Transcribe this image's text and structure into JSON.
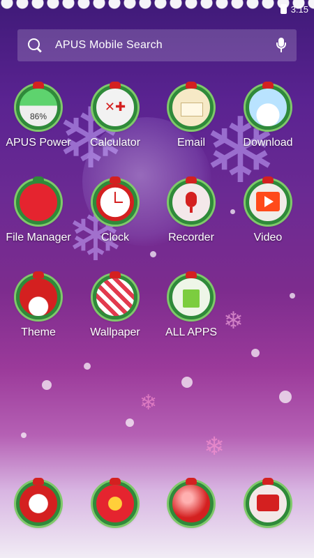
{
  "status_bar": {
    "time": "3:15"
  },
  "search": {
    "placeholder": "APUS Mobile Search"
  },
  "apps": [
    {
      "label": "APUS Power",
      "icon": "battery-icon",
      "badge": "86%"
    },
    {
      "label": "Calculator",
      "icon": "calculator-icon"
    },
    {
      "label": "Email",
      "icon": "email-icon"
    },
    {
      "label": "Download",
      "icon": "download-icon"
    },
    {
      "label": "File Manager",
      "icon": "folder-icon"
    },
    {
      "label": "Clock",
      "icon": "clock-icon"
    },
    {
      "label": "Recorder",
      "icon": "microphone-icon"
    },
    {
      "label": "Video",
      "icon": "video-play-icon"
    },
    {
      "label": "Theme",
      "icon": "santa-hat-icon"
    },
    {
      "label": "Wallpaper",
      "icon": "candy-cane-icon"
    },
    {
      "label": "ALL APPS",
      "icon": "gift-bag-icon"
    }
  ],
  "dock": [
    {
      "icon": "phone-icon"
    },
    {
      "icon": "camera-icon"
    },
    {
      "icon": "browser-icon"
    },
    {
      "icon": "messages-icon"
    }
  ],
  "colors": {
    "wreath": "#2f8a3a",
    "bow": "#d42020"
  }
}
